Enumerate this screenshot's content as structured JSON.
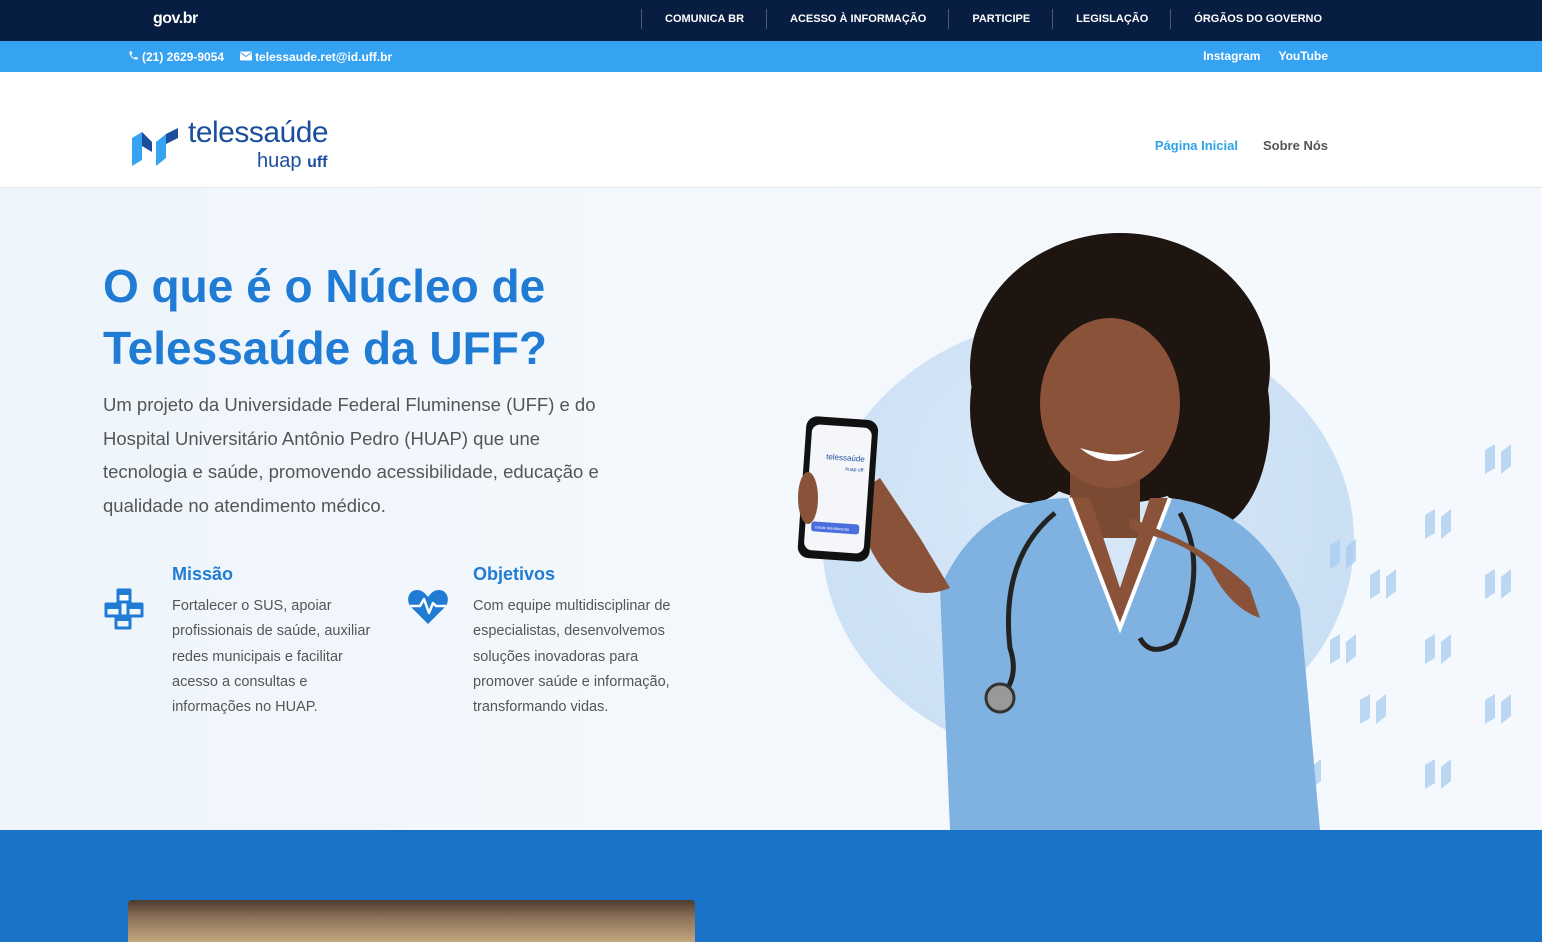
{
  "govbar": {
    "logo": "gov.br",
    "links": [
      "COMUNICA BR",
      "ACESSO À INFORMAÇÃO",
      "PARTICIPE",
      "LEGISLAÇÃO",
      "ÓRGÃOS DO GOVERNO"
    ]
  },
  "contact": {
    "phone": "(21) 2629-9054",
    "email": "telessaude.ret@id.uff.br",
    "social": [
      "Instagram",
      "YouTube"
    ]
  },
  "header": {
    "logo_top": "telessaúde",
    "logo_bottom": "huap",
    "logo_uff": "uff",
    "nav": [
      "Página Inicial",
      "Sobre Nós"
    ],
    "active_nav": "Página Inicial"
  },
  "hero": {
    "title": "O que é o Núcleo de Telessaúde da UFF?",
    "lead": "Um projeto da Universidade Federal Fluminense (UFF) e do Hospital Universitário Antônio Pedro (HUAP) que une tecnologia e saúde, promovendo acessibilidade, educação e qualidade no atendimento médico.",
    "features": [
      {
        "icon": "cubes-icon",
        "title": "Missão",
        "text": "Fortalecer o SUS, apoiar profissionais de saúde, auxiliar redes municipais e facilitar acesso a consultas e informações no HUAP."
      },
      {
        "icon": "heartbeat-icon",
        "title": "Objetivos",
        "text": "Com equipe multidisciplinar de especialistas, desenvolvemos soluções inovadoras para promover saúde e informação, transformando vidas."
      }
    ],
    "phone_screen_logo": "telessaúde",
    "phone_screen_sub": "huap uff",
    "phone_button": "Iniciar Atendimento"
  },
  "colors": {
    "gov_bar": "#071d41",
    "contact_bar": "#36a3f2",
    "accent": "#1f7bd3",
    "band": "#1b73c9"
  }
}
